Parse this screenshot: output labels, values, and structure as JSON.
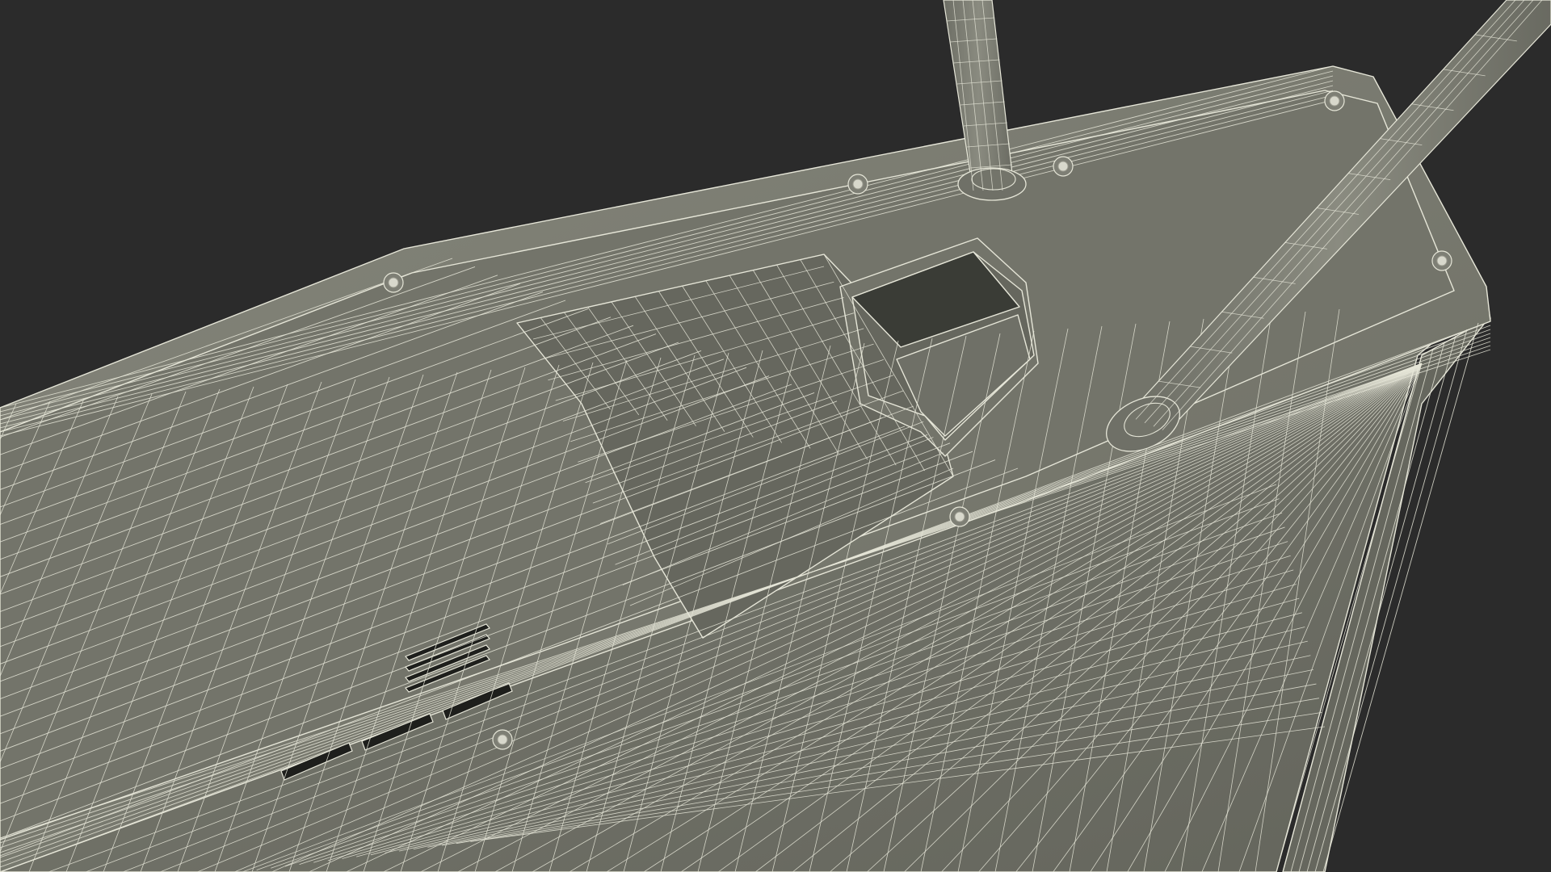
{
  "scene": {
    "subject": "wireframe-3d-model",
    "colors": {
      "background": "#2b2b2b",
      "surface_top": "#7e7f75",
      "surface_mid": "#73746a",
      "surface_dark": "#66675e",
      "surface_side": "#6f7067",
      "cavity": "#3a3c36",
      "slot": "#1e1f1c",
      "wire": "#e6e6d8",
      "screw": "#d8d8cc"
    }
  }
}
